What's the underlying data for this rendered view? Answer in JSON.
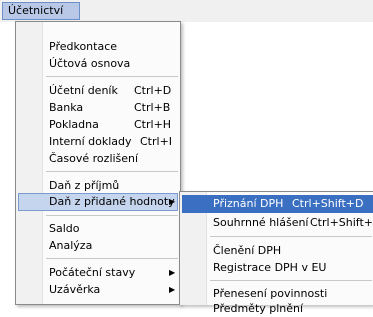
{
  "menubar": {
    "title": "Účetnictví"
  },
  "main_menu": {
    "items": [
      {
        "label": "Předkontace",
        "shortcut": ""
      },
      {
        "label": "Účtová osnova",
        "shortcut": ""
      },
      {
        "label": "Účetní deník",
        "shortcut": "Ctrl+D"
      },
      {
        "label": "Banka",
        "shortcut": "Ctrl+B"
      },
      {
        "label": "Pokladna",
        "shortcut": "Ctrl+H"
      },
      {
        "label": "Interní doklady",
        "shortcut": "Ctrl+I"
      },
      {
        "label": "Časové rozlišení",
        "shortcut": ""
      },
      {
        "label": "Daň z příjmů",
        "shortcut": ""
      },
      {
        "label": "Daň z přidané hodnoty",
        "shortcut": ""
      },
      {
        "label": "Saldo",
        "shortcut": ""
      },
      {
        "label": "Analýza",
        "shortcut": ""
      },
      {
        "label": "Počáteční stavy",
        "shortcut": ""
      },
      {
        "label": "Uzávěrka",
        "shortcut": ""
      }
    ]
  },
  "submenu": {
    "items": [
      {
        "label": "Přiznání DPH",
        "shortcut": "Ctrl+Shift+D"
      },
      {
        "label": "Souhrnné hlášení",
        "shortcut": "Ctrl+Shift+V"
      },
      {
        "label": "Členění DPH",
        "shortcut": ""
      },
      {
        "label": "Registrace DPH v EU",
        "shortcut": ""
      },
      {
        "label": "Přenesení povinnosti",
        "shortcut": ""
      },
      {
        "label": "Předměty plnění",
        "shortcut": ""
      }
    ]
  },
  "icons": {
    "submenu_arrow": "▶"
  },
  "colors": {
    "highlight": "#3b6fc1",
    "menubar_active": "#b8c8e6"
  }
}
